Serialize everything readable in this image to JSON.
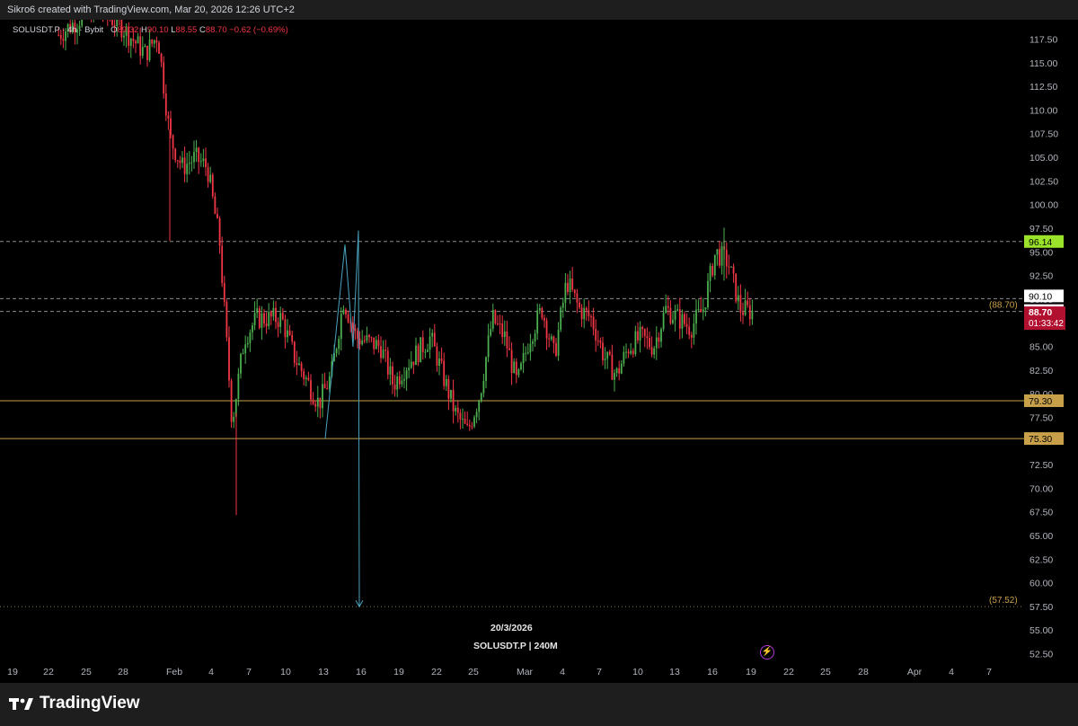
{
  "header": {
    "attribution": "Sikro6 created with TradingView.com, Mar 20, 2026 12:26 UTC+2"
  },
  "legend": {
    "symbol": "SOLUSDT.P · 4h · Bybit",
    "open_label": "O",
    "open": "89.32",
    "high_label": "H",
    "high": "90.10",
    "low_label": "L",
    "low": "88.55",
    "close_label": "C",
    "close": "88.70",
    "change": "−0.62 (−0.69%)"
  },
  "watermark": {
    "date": "20/3/2026",
    "symbol_interval": "SOLUSDT.P | 240M"
  },
  "brand": {
    "name": "TradingView"
  },
  "colors": {
    "background": "#000000",
    "up": "#26a69a",
    "up_bright": "#4caf50",
    "down": "#f23645",
    "support_line": "#c8a04a",
    "projection": "#4aa3bf",
    "resistance_label_bg": "#9be32a",
    "price_label_bg": "#b2102f"
  },
  "chart_data": {
    "type": "candlestick",
    "title": "",
    "symbol": "SOLUSDT.P",
    "interval": "4h",
    "exchange": "Bybit",
    "ylim": [
      51.5,
      120
    ],
    "y_ticks": [
      "117.50",
      "115.00",
      "112.50",
      "110.00",
      "107.50",
      "105.00",
      "102.50",
      "100.00",
      "97.50",
      "95.00",
      "92.50",
      "90.00",
      "87.50",
      "85.00",
      "82.50",
      "80.00",
      "77.50",
      "75.00",
      "72.50",
      "70.00",
      "67.50",
      "65.00",
      "62.50",
      "60.00",
      "57.50",
      "55.00",
      "52.50"
    ],
    "x_ticks": [
      "19",
      "22",
      "25",
      "28",
      "Feb",
      "4",
      "7",
      "10",
      "13",
      "16",
      "19",
      "22",
      "25",
      "Mar",
      "4",
      "7",
      "10",
      "13",
      "16",
      "19",
      "22",
      "25",
      "28",
      "Apr",
      "4",
      "7"
    ],
    "x_range": [
      "2026-01-19",
      "2026-04-08"
    ],
    "price_path": [
      {
        "date": "2026-01-23",
        "price": 118
      },
      {
        "date": "2026-01-26",
        "price": 121
      },
      {
        "date": "2026-01-28",
        "price": 119
      },
      {
        "date": "2026-01-30",
        "price": 116
      },
      {
        "date": "2026-01-31",
        "price": 118
      },
      {
        "date": "2026-02-01",
        "price": 107
      },
      {
        "date": "2026-02-02",
        "price": 104
      },
      {
        "date": "2026-02-03",
        "price": 105
      },
      {
        "date": "2026-02-04",
        "price": 104
      },
      {
        "date": "2026-02-05",
        "price": 96
      },
      {
        "date": "2026-02-06",
        "price": 77
      },
      {
        "date": "2026-02-07",
        "price": 86
      },
      {
        "date": "2026-02-08",
        "price": 88
      },
      {
        "date": "2026-02-10",
        "price": 88
      },
      {
        "date": "2026-02-11",
        "price": 84
      },
      {
        "date": "2026-02-13",
        "price": 79
      },
      {
        "date": "2026-02-14",
        "price": 82
      },
      {
        "date": "2026-02-15",
        "price": 90
      },
      {
        "date": "2026-02-16",
        "price": 86
      },
      {
        "date": "2026-02-18",
        "price": 85
      },
      {
        "date": "2026-02-19",
        "price": 81
      },
      {
        "date": "2026-02-20",
        "price": 83
      },
      {
        "date": "2026-02-22",
        "price": 86
      },
      {
        "date": "2026-02-24",
        "price": 78
      },
      {
        "date": "2026-02-25",
        "price": 76
      },
      {
        "date": "2026-02-26",
        "price": 80
      },
      {
        "date": "2026-02-27",
        "price": 88
      },
      {
        "date": "2026-02-28",
        "price": 86
      },
      {
        "date": "2026-03-01",
        "price": 81
      },
      {
        "date": "2026-03-02",
        "price": 86
      },
      {
        "date": "2026-03-03",
        "price": 89
      },
      {
        "date": "2026-03-04",
        "price": 84
      },
      {
        "date": "2026-03-05",
        "price": 92
      },
      {
        "date": "2026-03-06",
        "price": 89
      },
      {
        "date": "2026-03-07",
        "price": 88
      },
      {
        "date": "2026-03-08",
        "price": 84
      },
      {
        "date": "2026-03-09",
        "price": 82
      },
      {
        "date": "2026-03-10",
        "price": 85
      },
      {
        "date": "2026-03-11",
        "price": 86
      },
      {
        "date": "2026-03-12",
        "price": 85
      },
      {
        "date": "2026-03-13",
        "price": 89
      },
      {
        "date": "2026-03-14",
        "price": 88
      },
      {
        "date": "2026-03-15",
        "price": 87
      },
      {
        "date": "2026-03-16",
        "price": 89
      },
      {
        "date": "2026-03-17",
        "price": 95
      },
      {
        "date": "2026-03-18",
        "price": 94
      },
      {
        "date": "2026-03-19",
        "price": 89
      },
      {
        "date": "2026-03-20",
        "price": 88.7
      }
    ],
    "horizontal_levels": [
      {
        "price": 96.14,
        "label": "96.14",
        "style": "dashed"
      },
      {
        "price": 90.1,
        "label": "90.10",
        "style": "dashed"
      },
      {
        "price": 88.74,
        "label": "88.74",
        "style": "dashed"
      },
      {
        "price": 79.3,
        "label": "79.30",
        "style": "solid"
      },
      {
        "price": 75.3,
        "label": "75.30",
        "style": "solid"
      },
      {
        "price": 57.52,
        "label": "(57.52)",
        "style": "dotted"
      }
    ],
    "last_price": {
      "value": "88.70",
      "countdown": "01:33:42",
      "annotation": "(88.70)"
    },
    "projection": {
      "points": [
        {
          "date": "2026-02-13",
          "price": 75.3
        },
        {
          "date": "2026-02-15",
          "price": 95.8
        },
        {
          "date": "2026-02-15",
          "price": 85
        },
        {
          "date": "2026-02-16",
          "price": 97.3
        },
        {
          "date": "2026-02-16",
          "price": 57.52
        }
      ]
    }
  }
}
